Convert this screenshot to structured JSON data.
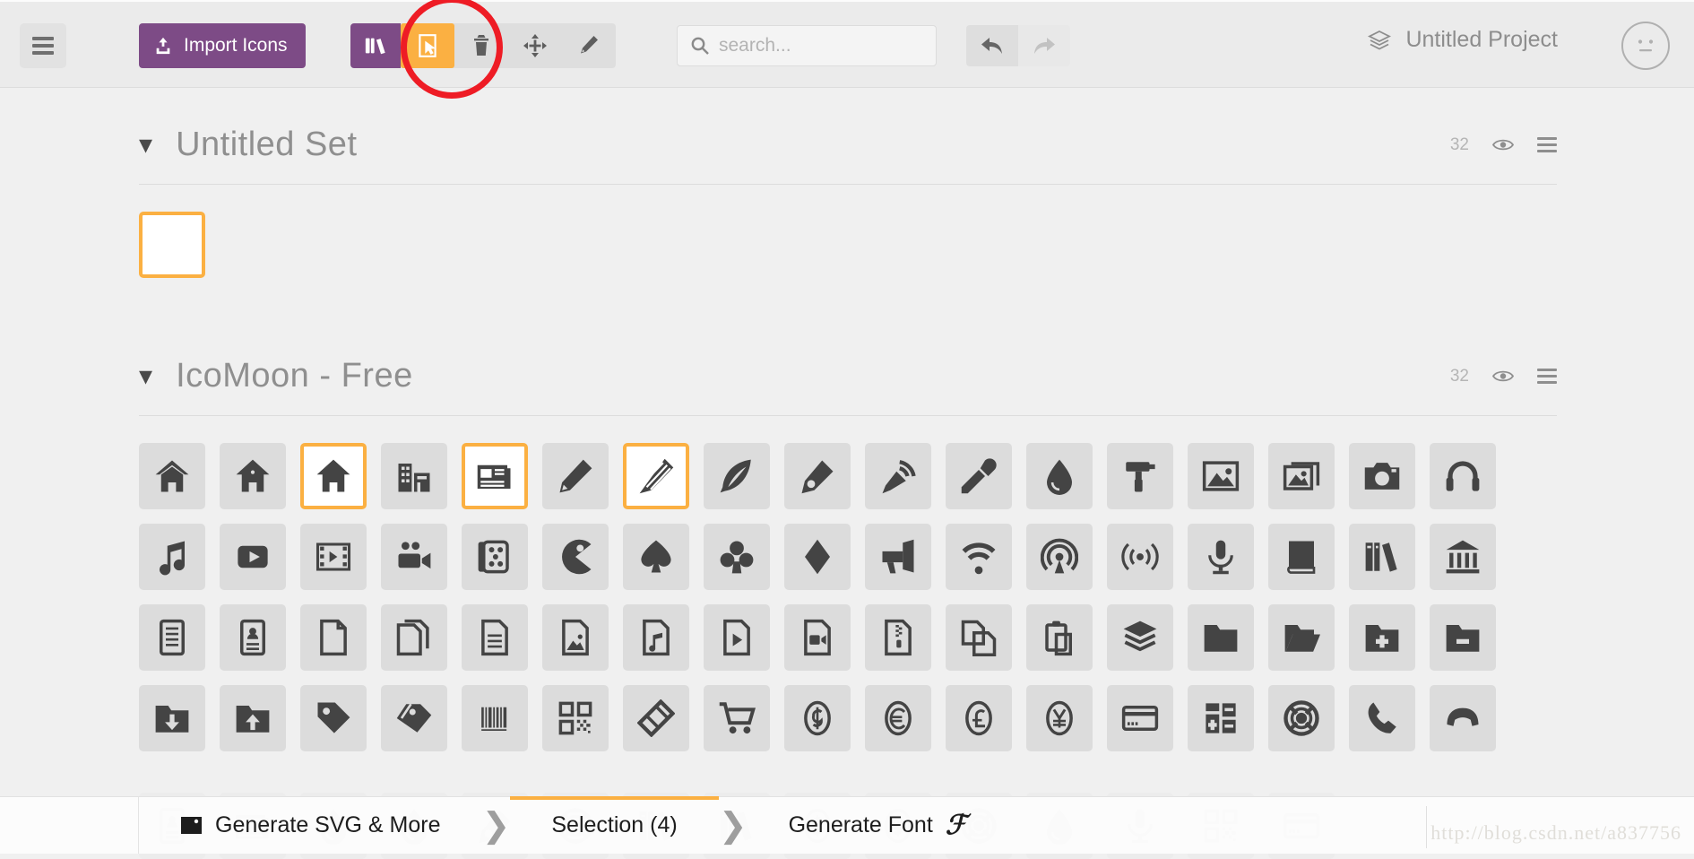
{
  "app": {
    "project_name": "Untitled Project",
    "project_icon": "layers-icon",
    "avatar_icon": "neutral-face-icon"
  },
  "toolbar": {
    "menu_icon": "hamburger-menu-icon",
    "import_label": "Import Icons",
    "import_icon": "upload-icon",
    "library_icon": "library-icon",
    "tools": [
      {
        "name": "select-tool",
        "icon": "cursor-select-icon",
        "active": true
      },
      {
        "name": "delete-tool",
        "icon": "trash-icon",
        "active": false
      },
      {
        "name": "move-tool",
        "icon": "move-arrows-icon",
        "active": false
      },
      {
        "name": "edit-tool",
        "icon": "pencil-icon",
        "active": false
      }
    ],
    "search": {
      "value": "",
      "placeholder": "search...",
      "icon": "search-icon"
    },
    "undo": {
      "icon": "undo-arrow-icon",
      "enabled": true
    },
    "redo": {
      "icon": "redo-arrow-icon",
      "enabled": false
    }
  },
  "annotation": {
    "shape": "red-circle-highlight",
    "target": "select-tool",
    "color": "#ee1c25"
  },
  "sets": [
    {
      "title": "Untitled Set",
      "count": "32",
      "chevron": "chevron-down-icon",
      "eye_icon": "eye-icon",
      "menu_icon": "list-menu-icon",
      "icons": [
        {
          "name": "blank-icon",
          "glyph": "blank",
          "selected": true
        }
      ]
    },
    {
      "title": "IcoMoon - Free",
      "count": "32",
      "chevron": "chevron-down-icon",
      "eye_icon": "eye-icon",
      "menu_icon": "list-menu-icon",
      "icons": [
        {
          "name": "home-outline-icon",
          "glyph": "home1",
          "selected": false
        },
        {
          "name": "home-icon",
          "glyph": "home2",
          "selected": false
        },
        {
          "name": "home-solid-icon",
          "glyph": "home3",
          "selected": true
        },
        {
          "name": "office-icon",
          "glyph": "office",
          "selected": false
        },
        {
          "name": "newspaper-icon",
          "glyph": "newspaper",
          "selected": true
        },
        {
          "name": "pencil-icon",
          "glyph": "pencil",
          "selected": false
        },
        {
          "name": "pencil2-icon",
          "glyph": "pencil2",
          "selected": true
        },
        {
          "name": "quill-icon",
          "glyph": "quill",
          "selected": false
        },
        {
          "name": "pen-icon",
          "glyph": "pen",
          "selected": false
        },
        {
          "name": "blog-icon",
          "glyph": "blog",
          "selected": false
        },
        {
          "name": "eyedropper-icon",
          "glyph": "eyedropper",
          "selected": false
        },
        {
          "name": "droplet-icon",
          "glyph": "droplet",
          "selected": false
        },
        {
          "name": "paint-format-icon",
          "glyph": "paint-format",
          "selected": false
        },
        {
          "name": "image-icon",
          "glyph": "image",
          "selected": false
        },
        {
          "name": "images-icon",
          "glyph": "images",
          "selected": false
        },
        {
          "name": "camera-icon",
          "glyph": "camera",
          "selected": false
        },
        {
          "name": "headphones-icon",
          "glyph": "headphones",
          "selected": false
        },
        {
          "name": "music-icon",
          "glyph": "music",
          "selected": false
        },
        {
          "name": "play-icon",
          "glyph": "play",
          "selected": false
        },
        {
          "name": "film-icon",
          "glyph": "film",
          "selected": false
        },
        {
          "name": "video-camera-icon",
          "glyph": "video-camera",
          "selected": false
        },
        {
          "name": "dice-icon",
          "glyph": "dice",
          "selected": false
        },
        {
          "name": "pacman-icon",
          "glyph": "pacman",
          "selected": false
        },
        {
          "name": "spades-icon",
          "glyph": "spades",
          "selected": false
        },
        {
          "name": "clubs-icon",
          "glyph": "clubs",
          "selected": false
        },
        {
          "name": "diamonds-icon",
          "glyph": "diamonds",
          "selected": false
        },
        {
          "name": "bullhorn-icon",
          "glyph": "bullhorn",
          "selected": false
        },
        {
          "name": "connection-icon",
          "glyph": "connection",
          "selected": false
        },
        {
          "name": "podcast-icon",
          "glyph": "podcast",
          "selected": false
        },
        {
          "name": "feed-icon",
          "glyph": "feed",
          "selected": false
        },
        {
          "name": "mic-icon",
          "glyph": "mic",
          "selected": false
        },
        {
          "name": "book-icon",
          "glyph": "book",
          "selected": false
        },
        {
          "name": "books-icon",
          "glyph": "books",
          "selected": false
        },
        {
          "name": "library-icon",
          "glyph": "library",
          "selected": false
        },
        {
          "name": "file-text-icon",
          "glyph": "file-text",
          "selected": false
        },
        {
          "name": "profile-icon",
          "glyph": "profile",
          "selected": false
        },
        {
          "name": "file-empty-icon",
          "glyph": "file-empty",
          "selected": false
        },
        {
          "name": "files-empty-icon",
          "glyph": "files-empty",
          "selected": false
        },
        {
          "name": "file-text2-icon",
          "glyph": "file-text2",
          "selected": false
        },
        {
          "name": "file-picture-icon",
          "glyph": "file-picture",
          "selected": false
        },
        {
          "name": "file-music-icon",
          "glyph": "file-music",
          "selected": false
        },
        {
          "name": "file-play-icon",
          "glyph": "file-play",
          "selected": false
        },
        {
          "name": "file-video-icon",
          "glyph": "file-video",
          "selected": false
        },
        {
          "name": "file-zip-icon",
          "glyph": "file-zip",
          "selected": false
        },
        {
          "name": "copy-icon",
          "glyph": "copy",
          "selected": false
        },
        {
          "name": "paste-icon",
          "glyph": "paste",
          "selected": false
        },
        {
          "name": "stack-icon",
          "glyph": "stack",
          "selected": false
        },
        {
          "name": "folder-icon",
          "glyph": "folder",
          "selected": false
        },
        {
          "name": "folder-open-icon",
          "glyph": "folder-open",
          "selected": false
        },
        {
          "name": "folder-plus-icon",
          "glyph": "folder-plus",
          "selected": false
        },
        {
          "name": "folder-minus-icon",
          "glyph": "folder-minus",
          "selected": false
        },
        {
          "name": "folder-download-icon",
          "glyph": "folder-download",
          "selected": false
        },
        {
          "name": "folder-upload-icon",
          "glyph": "folder-upload",
          "selected": false
        },
        {
          "name": "price-tag-icon",
          "glyph": "price-tag",
          "selected": false
        },
        {
          "name": "price-tags-icon",
          "glyph": "price-tags",
          "selected": false
        },
        {
          "name": "barcode-icon",
          "glyph": "barcode",
          "selected": false
        },
        {
          "name": "qrcode-icon",
          "glyph": "qrcode",
          "selected": false
        },
        {
          "name": "ticket-icon",
          "glyph": "ticket",
          "selected": false
        },
        {
          "name": "cart-icon",
          "glyph": "cart",
          "selected": false
        },
        {
          "name": "coin-dollar-icon",
          "glyph": "coin-dollar",
          "selected": false
        },
        {
          "name": "coin-euro-icon",
          "glyph": "coin-euro",
          "selected": false
        },
        {
          "name": "coin-pound-icon",
          "glyph": "coin-pound",
          "selected": false
        },
        {
          "name": "coin-yen-icon",
          "glyph": "coin-yen",
          "selected": false
        },
        {
          "name": "credit-card-icon",
          "glyph": "credit-card",
          "selected": false
        },
        {
          "name": "calculator-icon",
          "glyph": "calculator",
          "selected": false
        },
        {
          "name": "lifebuoy-icon",
          "glyph": "lifebuoy",
          "selected": false
        },
        {
          "name": "phone-icon",
          "glyph": "phone",
          "selected": false
        },
        {
          "name": "phone-hang-up-icon",
          "glyph": "phone-hang-up",
          "selected": false
        }
      ]
    }
  ],
  "ghost_icons": [
    "contact-card-icon",
    "envelope-icon",
    "location-pin-icon",
    "map-pin-icon",
    "compass-needle-icon",
    "compass-icon",
    "map-icon",
    "map2-icon",
    "clock-icon",
    "clock2-icon",
    "alarm-icon",
    "bell-icon",
    "stopwatch-icon",
    "calendar-icon",
    "printer-icon"
  ],
  "bottom_bar": {
    "tabs": [
      {
        "label": "Generate SVG & More",
        "icon": "image-frame-icon",
        "active": false
      },
      {
        "label": "Selection (4)",
        "icon": "",
        "active": true
      },
      {
        "label": "Generate Font",
        "icon": "font-f-icon",
        "active": false
      }
    ],
    "watermark": "http://blog.csdn.net/a837756"
  },
  "colors": {
    "accent": "#fbb042",
    "brand_purple": "#7d4b86",
    "annotation_red": "#ee1c25",
    "app_bg": "#f0f0f0",
    "cell_bg": "#dcdcdc"
  }
}
